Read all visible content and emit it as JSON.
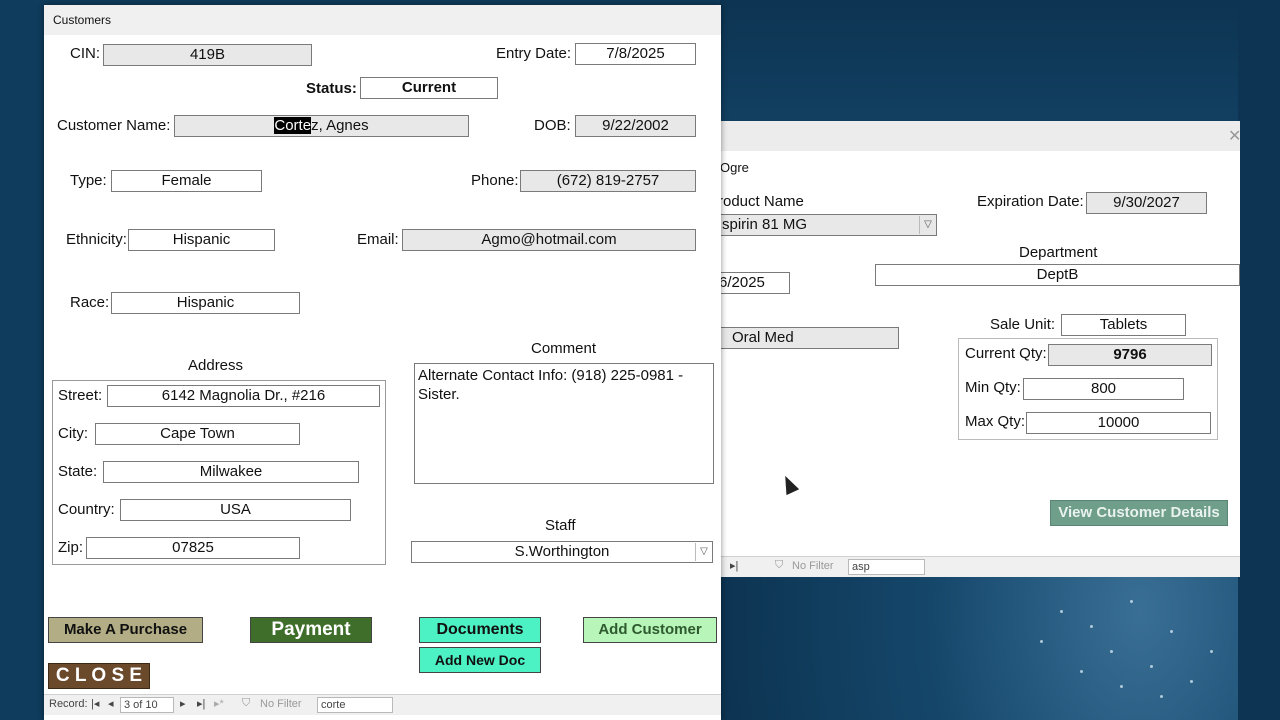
{
  "main_window": {
    "title": "Customers",
    "cin_label": "CIN:",
    "cin_value": "419B",
    "entry_date_label": "Entry Date:",
    "entry_date_value": "7/8/2025",
    "status_label": "Status:",
    "status_value": "Current",
    "customer_name_label": "Customer Name:",
    "customer_name_selected": "Corte",
    "customer_name_rest": "z, Agnes",
    "dob_label": "DOB:",
    "dob_value": "9/22/2002",
    "type_label": "Type:",
    "type_value": "Female",
    "phone_label": "Phone:",
    "phone_value": "(672) 819-2757",
    "ethnicity_label": "Ethnicity:",
    "ethnicity_value": "Hispanic",
    "email_label": "Email:",
    "email_value": "Agmo@hotmail.com",
    "race_label": "Race:",
    "race_value": "Hispanic",
    "address_heading": "Address",
    "street_label": "Street:",
    "street_value": "6142 Magnolia Dr., #216",
    "city_label": "City:",
    "city_value": "Cape Town",
    "state_label": "State:",
    "state_value": "Milwakee",
    "country_label": "Country:",
    "country_value": "USA",
    "zip_label": "Zip:",
    "zip_value": "07825",
    "comment_heading": "Comment",
    "comment_value": "Alternate Contact Info: (918) 225-0981 - Sister.",
    "staff_heading": "Staff",
    "staff_value": "S.Worthington",
    "buttons": {
      "make_purchase": "Make A Purchase",
      "payment": "Payment",
      "documents": "Documents",
      "add_new_doc": "Add New Doc",
      "add_customer": "Add Customer",
      "close": "C L O S E"
    },
    "nav": {
      "record_label": "Record:",
      "position": "3 of 10",
      "no_filter": "No Filter",
      "search": "corte"
    }
  },
  "back_window": {
    "ogre": "Ogre",
    "product_name_label": "roduct Name",
    "product_value": "spirin 81 MG",
    "expiration_label": "Expiration Date:",
    "expiration_value": "9/30/2027",
    "department_label": "Department",
    "department_value": "DeptB",
    "date_partial": "6/2025",
    "oral_med": "Oral Med",
    "sale_unit_label": "Sale Unit:",
    "sale_unit_value": "Tablets",
    "current_qty_label": "Current Qty:",
    "current_qty_value": "9796",
    "min_qty_label": "Min Qty:",
    "min_qty_value": "800",
    "max_qty_label": "Max Qty:",
    "max_qty_value": "10000",
    "view_details_button": "View Customer Details",
    "nav": {
      "no_filter": "No Filter",
      "search": "asp"
    }
  },
  "colors": {
    "make_purchase_bg": "#b2ad85",
    "payment_bg": "#3f6e2b",
    "documents_bg": "#4cf2c4",
    "add_customer_bg": "#b8f5b8",
    "close_bg": "#6b4a2b",
    "view_details_bg": "#6f9e8a"
  }
}
